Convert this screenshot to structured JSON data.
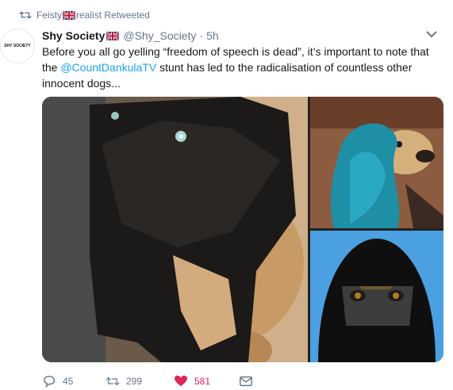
{
  "retweet_context": {
    "user_prefix": "Feisty",
    "user_suffix": "realist",
    "label": "Retweeted"
  },
  "tweet": {
    "avatar_text": "SHY SOCIETY",
    "display_name": "Shy Society",
    "handle": "@Shy_Society",
    "separator": "·",
    "time": "5h",
    "text_part1": "Before you all go yelling “freedom of speech is dead”, it’s important to note that the ",
    "mention": "@CountDankulaTV",
    "text_part2": " stunt has led to the radicalisation of countless other innocent dogs..."
  },
  "media": {
    "left_alt": "dog wearing black face covering",
    "top_right_alt": "dog wearing teal sparkly headscarf",
    "bottom_right_alt": "dog wearing black face covering with eye slit"
  },
  "actions": {
    "reply_count": "45",
    "retweet_count": "299",
    "like_count": "581"
  },
  "colors": {
    "accent": "#1da1f2",
    "like": "#e0245e",
    "muted": "#657786",
    "text": "#14171a"
  },
  "icons": [
    "retweet-icon",
    "uk-flag-icon",
    "caret-down-icon",
    "reply-icon",
    "like-icon",
    "message-icon"
  ]
}
